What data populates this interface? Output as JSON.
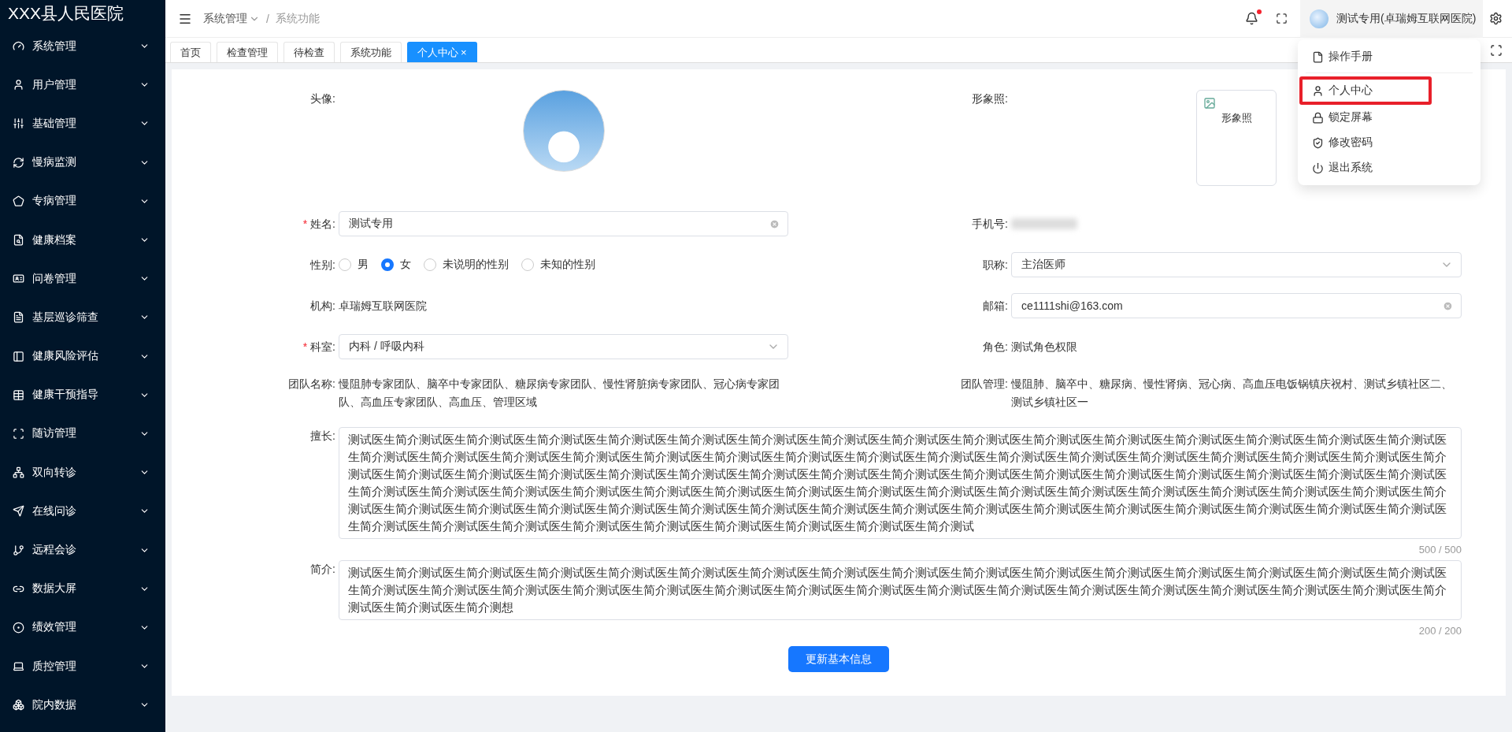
{
  "sidebar": {
    "title": "XXX县人民医院",
    "items": [
      {
        "label": "系统管理"
      },
      {
        "label": "用户管理"
      },
      {
        "label": "基础管理"
      },
      {
        "label": "慢病监测"
      },
      {
        "label": "专病管理"
      },
      {
        "label": "健康档案"
      },
      {
        "label": "问卷管理"
      },
      {
        "label": "基层巡诊筛查"
      },
      {
        "label": "健康风险评估"
      },
      {
        "label": "健康干预指导"
      },
      {
        "label": "随访管理"
      },
      {
        "label": "双向转诊"
      },
      {
        "label": "在线问诊"
      },
      {
        "label": "远程会诊"
      },
      {
        "label": "数据大屏"
      },
      {
        "label": "绩效管理"
      },
      {
        "label": "质控管理"
      },
      {
        "label": "院内数据"
      }
    ]
  },
  "header": {
    "breadcrumb": [
      "系统管理",
      "系统功能"
    ],
    "separator": "/",
    "notification_dot": true,
    "user_name": "测试专用(卓瑞姆互联网医院)"
  },
  "tabs": [
    {
      "label": "首页",
      "selected": false
    },
    {
      "label": "检查管理",
      "selected": false
    },
    {
      "label": "待检查",
      "selected": false
    },
    {
      "label": "系统功能",
      "selected": false
    },
    {
      "label": "个人中心",
      "selected": true,
      "close": "×"
    }
  ],
  "user_menu": [
    {
      "label": "操作手册",
      "highlighted": false
    },
    {
      "label": "个人中心",
      "highlighted": true
    },
    {
      "label": "锁定屏幕",
      "highlighted": false
    },
    {
      "label": "修改密码",
      "highlighted": false
    },
    {
      "label": "退出系统",
      "highlighted": false
    }
  ],
  "form": {
    "rows": [
      [
        {
          "kind": "avatar",
          "label": "头像:"
        },
        {
          "kind": "portrait",
          "label": "形象照:",
          "alt": "形象照"
        }
      ],
      [
        {
          "kind": "input",
          "label": "姓名:",
          "required_mark": "*",
          "value": "测试专用"
        },
        {
          "kind": "blurred",
          "label": "手机号:"
        }
      ],
      [
        {
          "kind": "radio",
          "label": "性别:",
          "options": [
            {
              "label": "男",
              "selected": false
            },
            {
              "label": "女",
              "selected": true
            },
            {
              "label": "未说明的性别",
              "selected": false
            },
            {
              "label": "未知的性别",
              "selected": false
            }
          ]
        },
        {
          "kind": "select",
          "label": "职称:",
          "value": "主治医师"
        }
      ],
      [
        {
          "kind": "text",
          "label": "机构:",
          "value": "卓瑞姆互联网医院"
        },
        {
          "kind": "input",
          "label": "邮箱:",
          "value": "ce1111shi@163.com"
        }
      ],
      [
        {
          "kind": "select",
          "label": "科室:",
          "required_mark": "*",
          "value": "内科 / 呼吸内科"
        },
        {
          "kind": "text",
          "label": "角色:",
          "value": "测试角色权限"
        }
      ],
      [
        {
          "kind": "text",
          "label": "团队名称:",
          "value": "慢阻肺专家团队、脑卒中专家团队、糖尿病专家团队、慢性肾脏病专家团队、冠心病专家团队、高血压专家团队、高血压、管理区域"
        },
        {
          "kind": "text",
          "label": "团队管理:",
          "value": "慢阻肺、脑卒中、糖尿病、慢性肾病、冠心病、高血压电饭锅镇庆祝村、测试乡镇社区二、测试乡镇社区一"
        }
      ]
    ],
    "textareas": [
      {
        "label": "擅长:",
        "value": "测试医生简介测试医生简介测试医生简介测试医生简介测试医生简介测试医生简介测试医生简介测试医生简介测试医生简介测试医生简介测试医生简介测试医生简介测试医生简介测试医生简介测试医生简介测试医生简介测试医生简介测试医生简介测试医生简介测试医生简介测试医生简介测试医生简介测试医生简介测试医生简介测试医生简介测试医生简介测试医生简介测试医生简介测试医生简介测试医生简介测试医生简介测试医生简介测试医生简介测试医生简介测试医生简介测试医生简介测试医生简介测试医生简介测试医生简介测试医生简介测试医生简介测试医生简介测试医生简介测试医生简介测试医生简介测试医生简介测试医生简介测试医生简介测试医生简介测试医生简介测试医生简介测试医生简介测试医生简介测试医生简介测试医生简介测试医生简介测试医生简介测试医生简介测试医生简介测试医生简介测试医生简介测试医生简介测试医生简介测试医生简介测试医生简介测试医生简介测试医生简介测试医生简介测试医生简介测试医生简介测试医生简介测试医生简介测试医生简介测试医生简介测试医生简介测试医生简介测试医生简介测试医生简介测试医生简介测试医生简介测试医生简介测试医生简介测试医生简介测试医生简介测试医生简介测试医生简介测试",
        "counter": "500 / 500"
      },
      {
        "label": "简介:",
        "value": "测试医生简介测试医生简介测试医生简介测试医生简介测试医生简介测试医生简介测试医生简介测试医生简介测试医生简介测试医生简介测试医生简介测试医生简介测试医生简介测试医生简介测试医生简介测试医生简介测试医生简介测试医生简介测试医生简介测试医生简介测试医生简介测试医生简介测试医生简介测试医生简介测试医生简介测试医生简介测试医生简介测试医生简介测试医生简介测试医生简介测试医生简介测试医生简介测试医生简介测想",
        "counter": "200 / 200"
      }
    ],
    "submit": "更新基本信息"
  }
}
